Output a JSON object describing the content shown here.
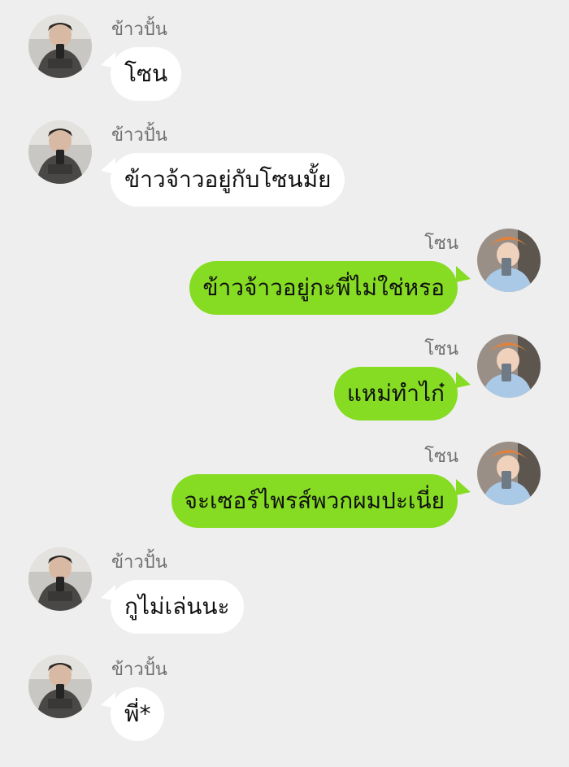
{
  "chat": {
    "messages": [
      {
        "sender": "ข้าวปั้น",
        "text": "โซน",
        "side": "incoming"
      },
      {
        "sender": "ข้าวปั้น",
        "text": "ข้าวจ้าวอยู่กับโซนมั้ย",
        "side": "incoming"
      },
      {
        "sender": "โซน",
        "text": "ข้าวจ้าวอยู่กะพี่ไม่ใช่หรอ",
        "side": "outgoing"
      },
      {
        "sender": "โซน",
        "text": "แหม่ทำไก๋",
        "side": "outgoing"
      },
      {
        "sender": "โซน",
        "text": "จะเซอร์ไพรส์พวกผมปะเนี่ย",
        "side": "outgoing"
      },
      {
        "sender": "ข้าวปั้น",
        "text": "กูไม่เล่นนะ",
        "side": "incoming"
      },
      {
        "sender": "ข้าวปั้น",
        "text": "พี่*",
        "side": "incoming"
      }
    ]
  },
  "colors": {
    "background": "#eeeeee",
    "incoming_bubble": "#ffffff",
    "outgoing_bubble": "#86dc22",
    "sender_name": "#6f6f6f"
  }
}
